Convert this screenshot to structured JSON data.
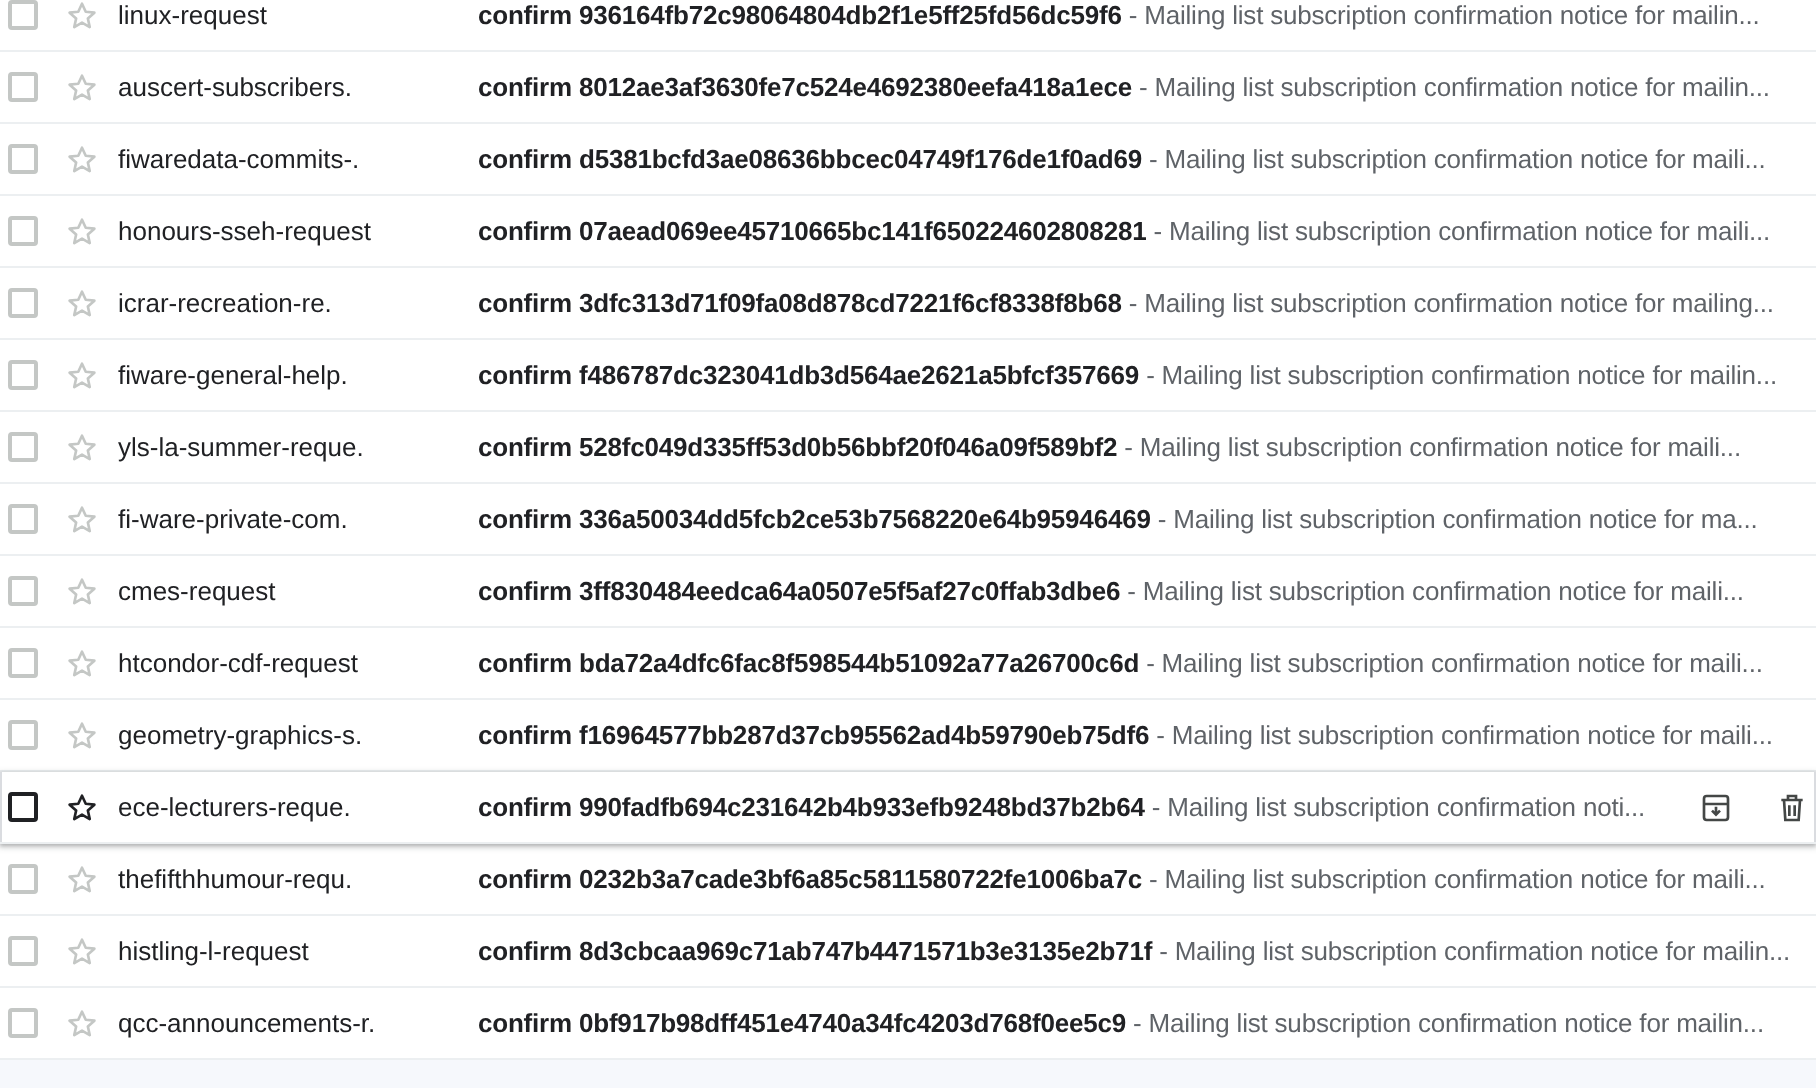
{
  "messages": [
    {
      "sender": "linux-request",
      "subject": "confirm 936164fb72c98064804db2f1e5ff25fd56dc59f6",
      "snippet": "- Mailing list subscription confirmation notice for mailin...",
      "checked": false,
      "starred": false,
      "hovered": false
    },
    {
      "sender": "auscert-subscribers.",
      "subject": "confirm 8012ae3af3630fe7c524e4692380eefa418a1ece",
      "snippet": "- Mailing list subscription confirmation notice for mailin...",
      "checked": false,
      "starred": false,
      "hovered": false
    },
    {
      "sender": "fiwaredata-commits-.",
      "subject": "confirm d5381bcfd3ae08636bbcec04749f176de1f0ad69",
      "snippet": "- Mailing list subscription confirmation notice for maili...",
      "checked": false,
      "starred": false,
      "hovered": false
    },
    {
      "sender": "honours-sseh-request",
      "subject": "confirm 07aead069ee45710665bc141f650224602808281",
      "snippet": "- Mailing list subscription confirmation notice for maili...",
      "checked": false,
      "starred": false,
      "hovered": false
    },
    {
      "sender": "icrar-recreation-re.",
      "subject": "confirm 3dfc313d71f09fa08d878cd7221f6cf8338f8b68",
      "snippet": "- Mailing list subscription confirmation notice for mailing...",
      "checked": false,
      "starred": false,
      "hovered": false
    },
    {
      "sender": "fiware-general-help.",
      "subject": "confirm f486787dc323041db3d564ae2621a5bfcf357669",
      "snippet": "- Mailing list subscription confirmation notice for mailin...",
      "checked": false,
      "starred": false,
      "hovered": false
    },
    {
      "sender": "yls-la-summer-reque.",
      "subject": "confirm 528fc049d335ff53d0b56bbf20f046a09f589bf2",
      "snippet": "- Mailing list subscription confirmation notice for maili...",
      "checked": false,
      "starred": false,
      "hovered": false
    },
    {
      "sender": "fi-ware-private-com.",
      "subject": "confirm 336a50034dd5fcb2ce53b7568220e64b95946469",
      "snippet": "- Mailing list subscription confirmation notice for ma...",
      "checked": false,
      "starred": false,
      "hovered": false
    },
    {
      "sender": "cmes-request",
      "subject": "confirm 3ff830484eedca64a0507e5f5af27c0ffab3dbe6",
      "snippet": "- Mailing list subscription confirmation notice for maili...",
      "checked": false,
      "starred": false,
      "hovered": false
    },
    {
      "sender": "htcondor-cdf-request",
      "subject": "confirm bda72a4dfc6fac8f598544b51092a77a26700c6d",
      "snippet": "- Mailing list subscription confirmation notice for maili...",
      "checked": false,
      "starred": false,
      "hovered": false
    },
    {
      "sender": "geometry-graphics-s.",
      "subject": "confirm f16964577bb287d37cb95562ad4b59790eb75df6",
      "snippet": "- Mailing list subscription confirmation notice for maili...",
      "checked": false,
      "starred": false,
      "hovered": false
    },
    {
      "sender": "ece-lecturers-reque.",
      "subject": "confirm 990fadfb694c231642b4b933efb9248bd37b2b64",
      "snippet": "- Mailing list subscription confirmation noti...",
      "checked": false,
      "starred": false,
      "hovered": true
    },
    {
      "sender": "thefifthhumour-requ.",
      "subject": "confirm 0232b3a7cade3bf6a85c5811580722fe1006ba7c",
      "snippet": "- Mailing list subscription confirmation notice for maili...",
      "checked": false,
      "starred": false,
      "hovered": false
    },
    {
      "sender": "histling-l-request",
      "subject": "confirm 8d3cbcaa969c71ab747b4471571b3e3135e2b71f",
      "snippet": "- Mailing list subscription confirmation notice for mailin...",
      "checked": false,
      "starred": false,
      "hovered": false
    },
    {
      "sender": "qcc-announcements-r.",
      "subject": "confirm 0bf917b98dff451e4740a34fc4203d768f0ee5c9",
      "snippet": "- Mailing list subscription confirmation notice for mailin...",
      "checked": false,
      "starred": false,
      "hovered": false
    }
  ]
}
